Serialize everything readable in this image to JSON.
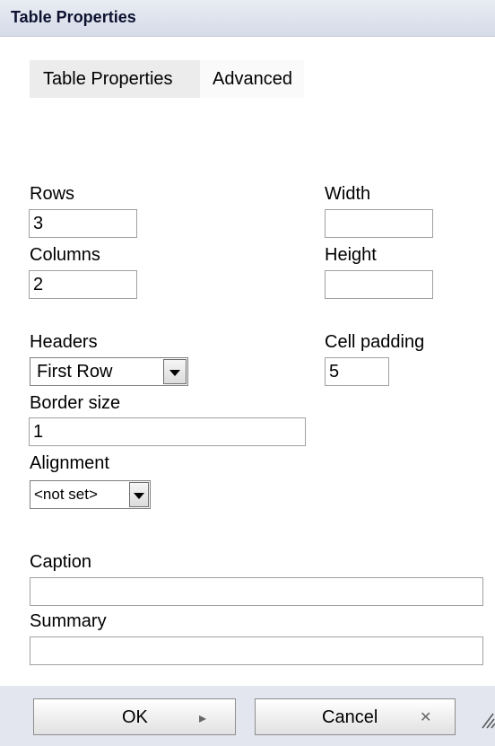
{
  "dialog": {
    "title": "Table Properties"
  },
  "tabs": [
    {
      "label": "Table Properties",
      "active": true
    },
    {
      "label": "Advanced",
      "active": false
    }
  ],
  "fields": {
    "rows": {
      "label": "Rows",
      "value": "3"
    },
    "columns": {
      "label": "Columns",
      "value": "2"
    },
    "width": {
      "label": "Width",
      "value": ""
    },
    "height": {
      "label": "Height",
      "value": ""
    },
    "headers": {
      "label": "Headers",
      "selected": "First Row"
    },
    "cell_padding": {
      "label": "Cell padding",
      "value": "5"
    },
    "border_size": {
      "label": "Border size",
      "value": "1"
    },
    "alignment": {
      "label": "Alignment",
      "selected": "<not set>"
    },
    "caption": {
      "label": "Caption",
      "value": ""
    },
    "summary": {
      "label": "Summary",
      "value": ""
    }
  },
  "buttons": {
    "ok": {
      "label": "OK",
      "icon": "triangle-right-icon"
    },
    "cancel": {
      "label": "Cancel",
      "icon": "x-icon"
    }
  }
}
